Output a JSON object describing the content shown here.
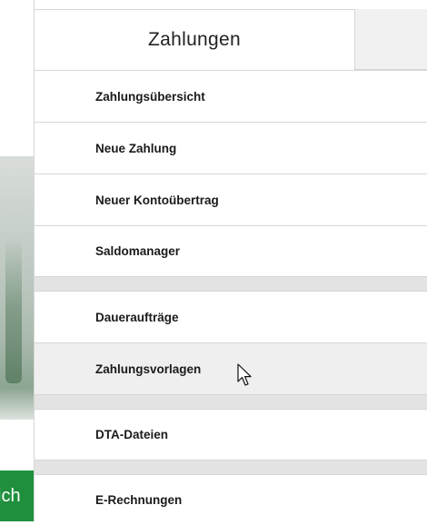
{
  "tabs": {
    "active_label": "Zahlungen"
  },
  "menu": {
    "items": [
      {
        "label": "Zahlungsübersicht"
      },
      {
        "label": "Neue Zahlung"
      },
      {
        "label": "Neuer Kontoübertrag"
      },
      {
        "label": "Saldomanager"
      },
      {
        "label": "Daueraufträge"
      },
      {
        "label": "Zahlungsvorlagen"
      },
      {
        "label": "DTA-Dateien"
      },
      {
        "label": "E-Rechnungen"
      }
    ]
  },
  "background": {
    "tile_text": "ich",
    "tile_color": "#1f8f3e"
  },
  "icons": {
    "cursor": "mouse-pointer-icon"
  }
}
